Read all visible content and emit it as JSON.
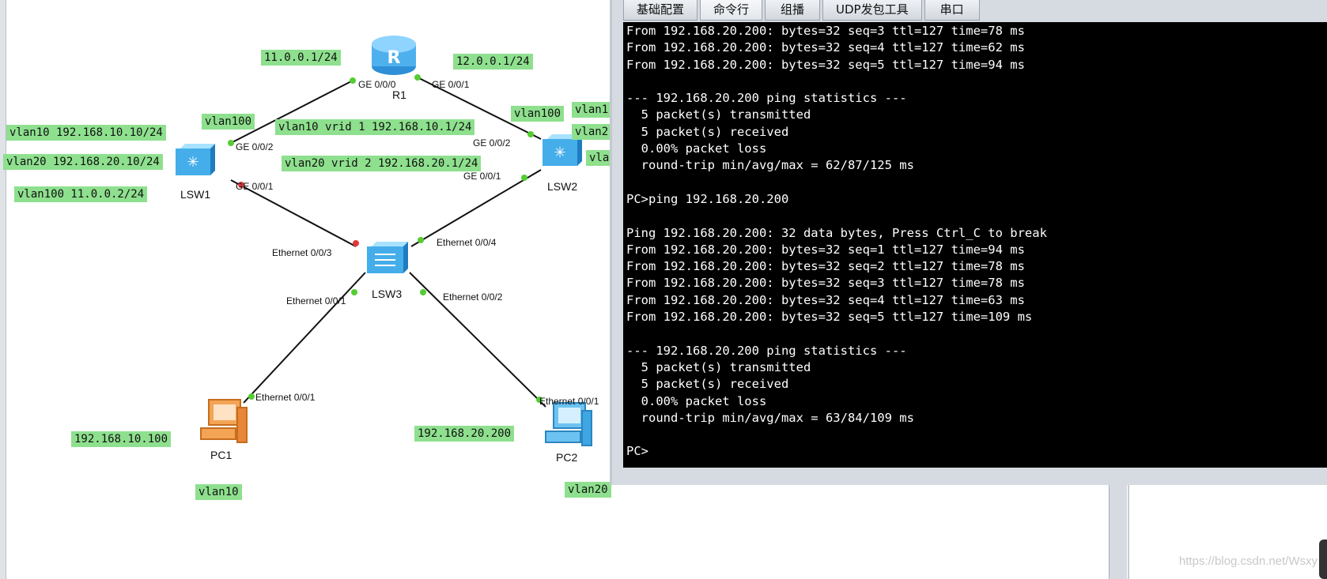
{
  "topology": {
    "devices": {
      "r1": "R1",
      "lsw1": "LSW1",
      "lsw2": "LSW2",
      "lsw3": "LSW3",
      "pc1": "PC1",
      "pc2": "PC2"
    },
    "labels": {
      "ip_11": "11.0.0.1/24",
      "ip_12": "12.0.0.1/24",
      "vlan100_left": "vlan100",
      "vlan100_right": "vlan100",
      "vlan1_right_cut": "vlan1",
      "vlan2_right_cut": "vlan2",
      "vla_right_cut": "vla",
      "lsw1_vlan10": "vlan10 192.168.10.10/24",
      "lsw1_vlan20": "vlan20 192.168.20.10/24",
      "lsw1_vlan100": "vlan100 11.0.0.2/24",
      "vrid1": "vlan10 vrid 1 192.168.10.1/24",
      "vrid2": "vlan20 vrid 2 192.168.20.1/24",
      "pc1_ip": "192.168.10.100",
      "pc2_ip": "192.168.20.200",
      "pc1_vlan": "vlan10",
      "pc2_vlan": "vlan20"
    },
    "ports": {
      "r1_ge000": "GE 0/0/0",
      "r1_ge001": "GE 0/0/1",
      "lsw1_ge002": "GE 0/0/2",
      "lsw1_ge001": "GE 0/0/1",
      "lsw2_ge002": "GE 0/0/2",
      "lsw2_ge001": "GE 0/0/1",
      "lsw3_eth003": "Ethernet 0/0/3",
      "lsw3_eth004": "Ethernet 0/0/4",
      "lsw3_eth001": "Ethernet 0/0/1",
      "lsw3_eth002": "Ethernet 0/0/2",
      "pc1_eth001": "Ethernet 0/0/1",
      "pc2_eth001": "Ethernet 0/0/1"
    }
  },
  "console": {
    "tabs": [
      "基础配置",
      "命令行",
      "组播",
      "UDP发包工具",
      "串口"
    ],
    "lines": [
      "From 192.168.20.200: bytes=32 seq=3 ttl=127 time=78 ms",
      "From 192.168.20.200: bytes=32 seq=4 ttl=127 time=62 ms",
      "From 192.168.20.200: bytes=32 seq=5 ttl=127 time=94 ms",
      "",
      "--- 192.168.20.200 ping statistics ---",
      "  5 packet(s) transmitted",
      "  5 packet(s) received",
      "  0.00% packet loss",
      "  round-trip min/avg/max = 62/87/125 ms",
      "",
      "PC>ping 192.168.20.200",
      "",
      "Ping 192.168.20.200: 32 data bytes, Press Ctrl_C to break",
      "From 192.168.20.200: bytes=32 seq=1 ttl=127 time=94 ms",
      "From 192.168.20.200: bytes=32 seq=2 ttl=127 time=78 ms",
      "From 192.168.20.200: bytes=32 seq=3 ttl=127 time=78 ms",
      "From 192.168.20.200: bytes=32 seq=4 ttl=127 time=63 ms",
      "From 192.168.20.200: bytes=32 seq=5 ttl=127 time=109 ms",
      "",
      "--- 192.168.20.200 ping statistics ---",
      "  5 packet(s) transmitted",
      "  5 packet(s) received",
      "  0.00% packet loss",
      "  round-trip min/avg/max = 63/84/109 ms",
      "",
      "PC>"
    ]
  },
  "watermark": "https://blog.csdn.net/Wsxy",
  "colors": {
    "label_bg": "#8ee08e",
    "terminal_bg": "#000000",
    "terminal_fg": "#ffffff",
    "port_up": "#55cc33",
    "port_down": "#e03a3a"
  }
}
